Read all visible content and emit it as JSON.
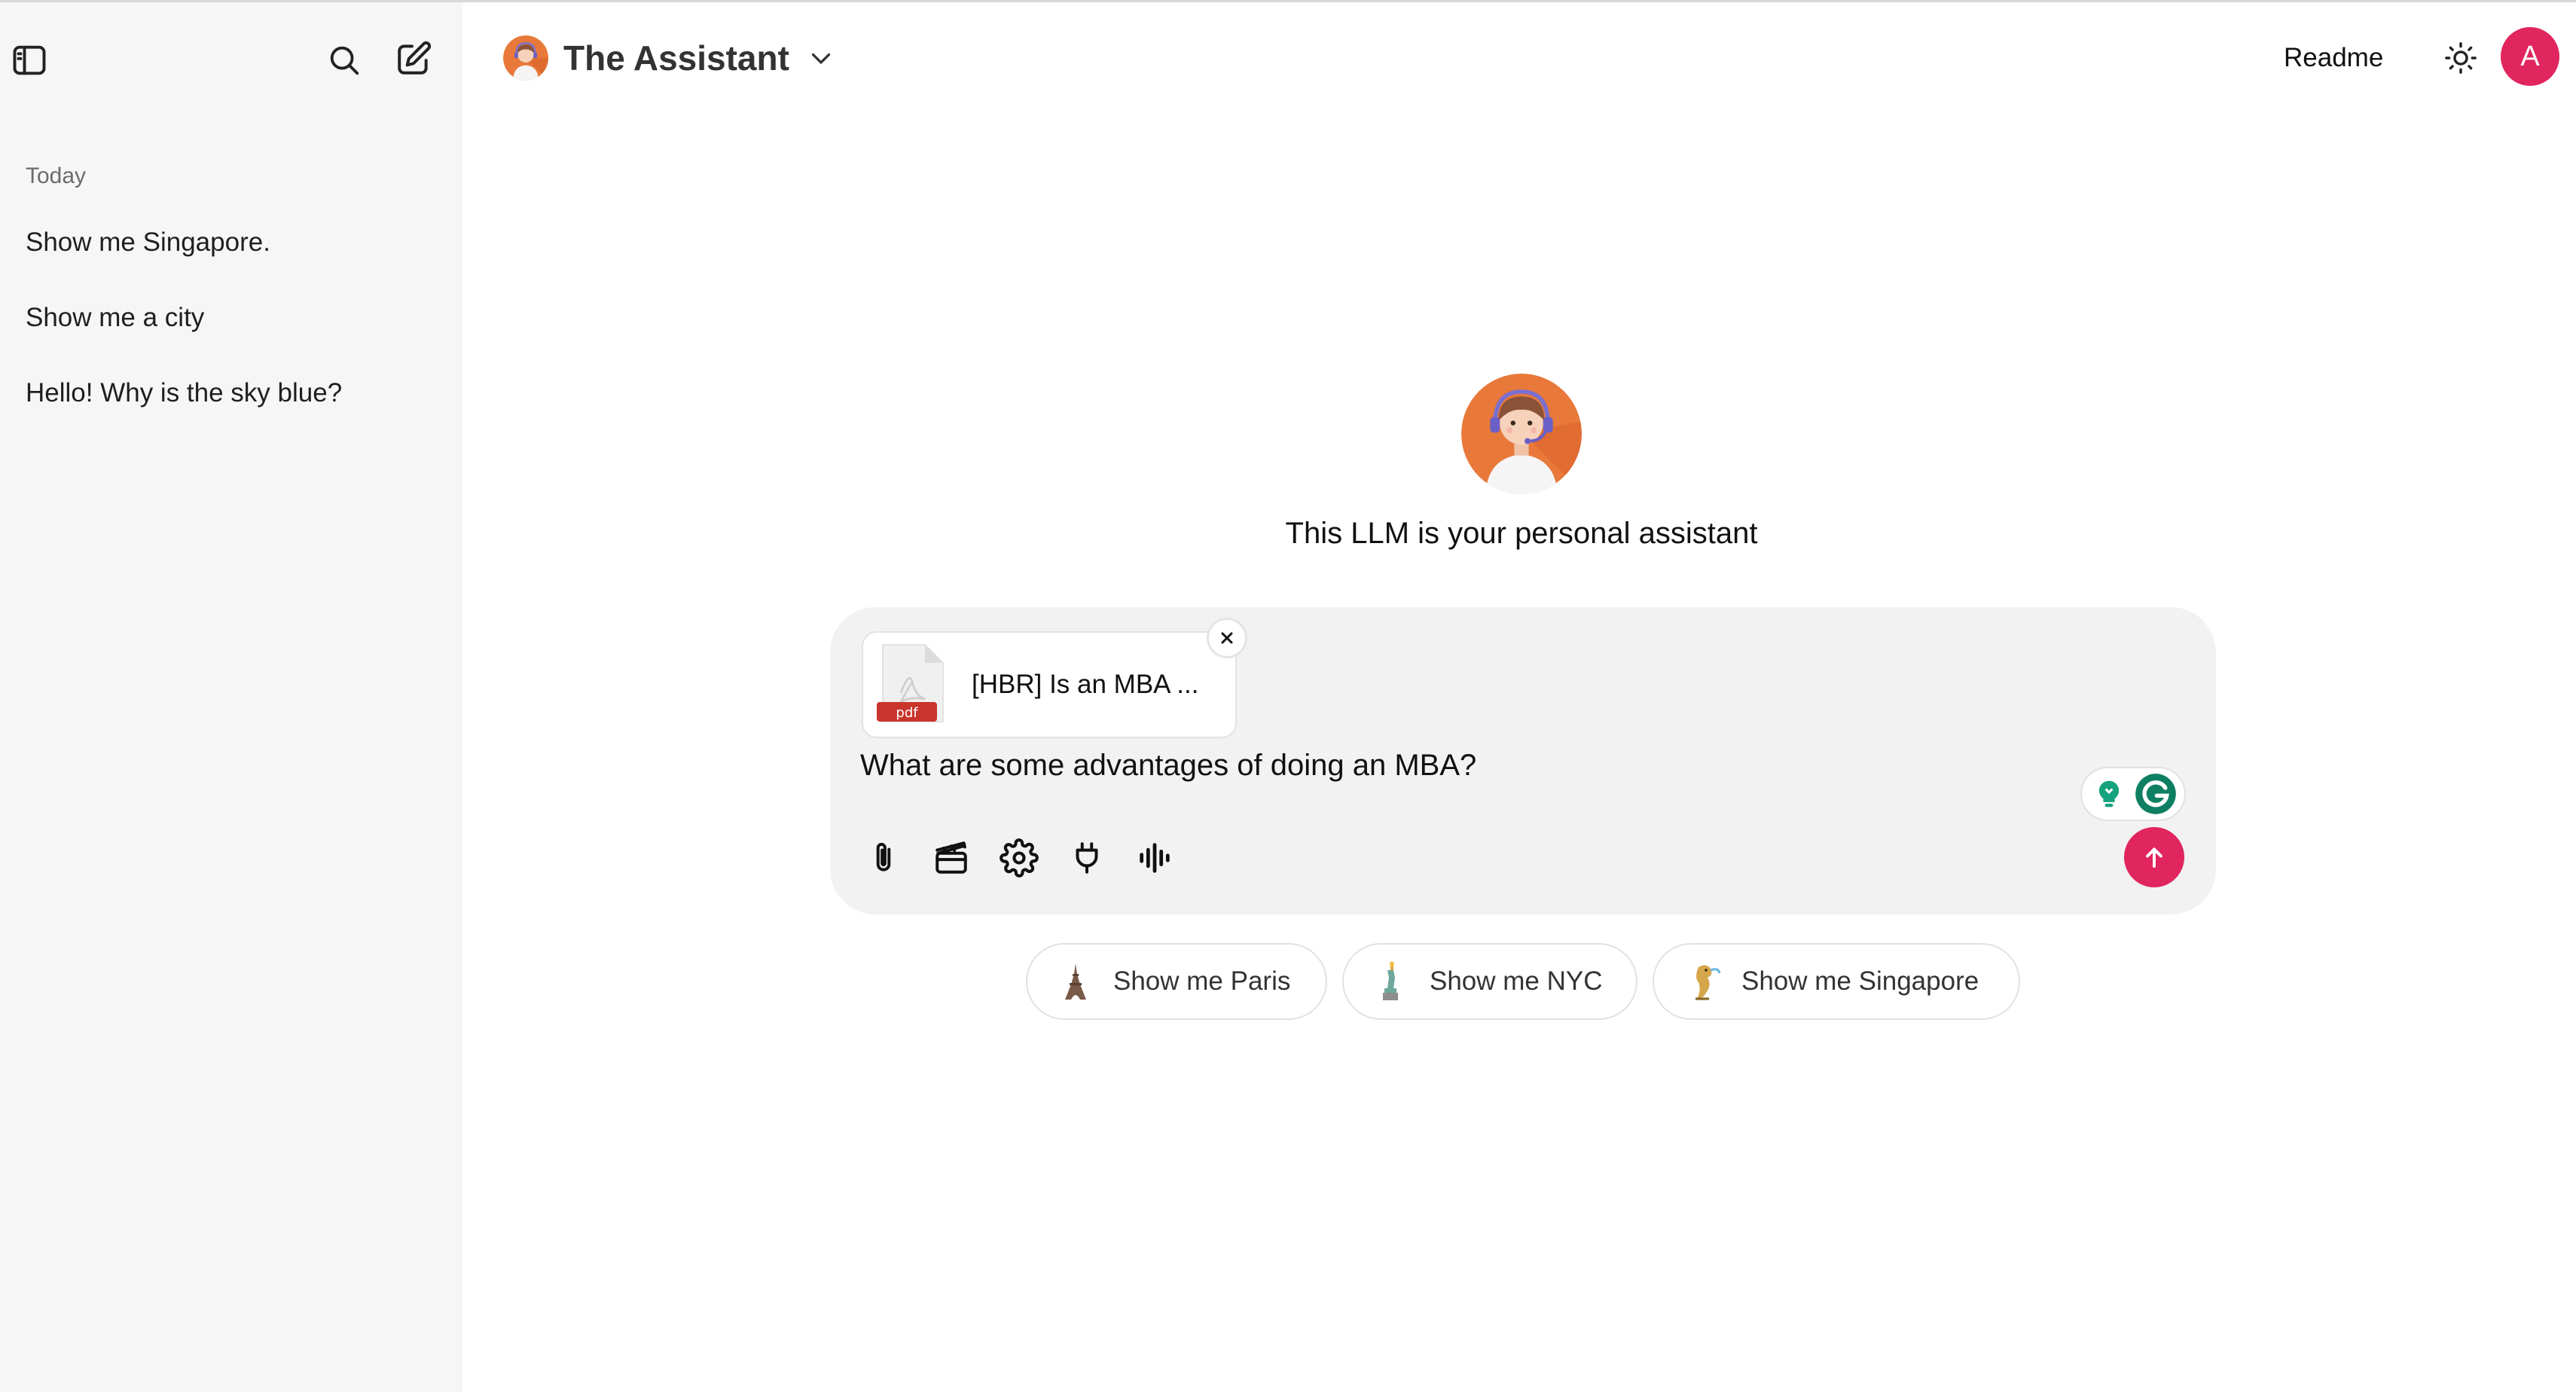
{
  "sidebar": {
    "history_heading": "Today",
    "items": [
      {
        "label": "Show me Singapore."
      },
      {
        "label": "Show me a city"
      },
      {
        "label": "Hello! Why is the sky blue?"
      }
    ]
  },
  "header": {
    "model_name": "The Assistant",
    "readme_label": "Readme",
    "user_initial": "A"
  },
  "welcome": {
    "tagline": "This LLM is your personal assistant"
  },
  "composer": {
    "attachment": {
      "name": "[HBR] Is an MBA ...",
      "type_label": "pdf"
    },
    "prompt": "What are some advantages of doing an MBA?"
  },
  "suggestions": [
    {
      "label": "Show me Paris",
      "icon": "eiffel-tower-icon"
    },
    {
      "label": "Show me NYC",
      "icon": "statue-of-liberty-icon"
    },
    {
      "label": "Show me Singapore",
      "icon": "merlion-icon"
    }
  ],
  "colors": {
    "accent": "#e0255f",
    "sidebar_bg": "#f6f6f6",
    "composer_bg": "#f2f2f2"
  }
}
